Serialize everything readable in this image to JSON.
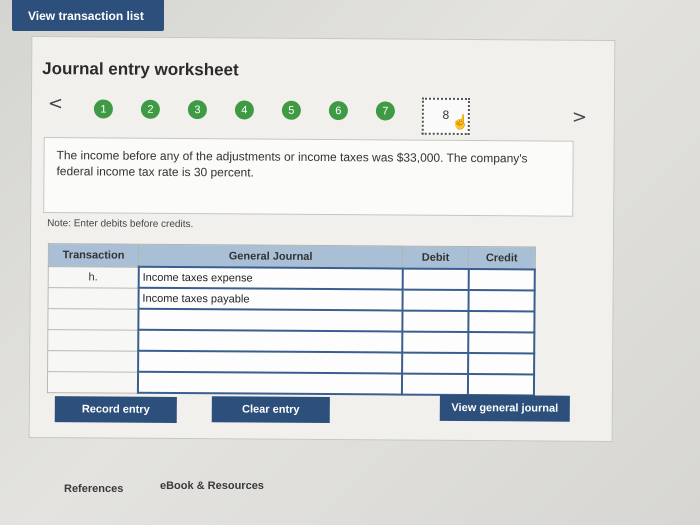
{
  "header": {
    "view_transaction_list": "View transaction list"
  },
  "worksheet": {
    "title": "Journal entry worksheet",
    "nav_prev": "<",
    "nav_next": ">",
    "steps": [
      "1",
      "2",
      "3",
      "4",
      "5",
      "6",
      "7"
    ],
    "current_step": "8",
    "description": "The income before any of the adjustments or income taxes was $33,000. The company's federal income tax rate is 30 percent.",
    "note": "Note: Enter debits before credits.",
    "table": {
      "headers": {
        "transaction": "Transaction",
        "general_journal": "General Journal",
        "debit": "Debit",
        "credit": "Credit"
      },
      "rows": [
        {
          "transaction": "h.",
          "account": "Income taxes expense",
          "debit": "",
          "credit": ""
        },
        {
          "transaction": "",
          "account": "Income taxes payable",
          "debit": "",
          "credit": ""
        },
        {
          "transaction": "",
          "account": "",
          "debit": "",
          "credit": ""
        },
        {
          "transaction": "",
          "account": "",
          "debit": "",
          "credit": ""
        },
        {
          "transaction": "",
          "account": "",
          "debit": "",
          "credit": ""
        },
        {
          "transaction": "",
          "account": "",
          "debit": "",
          "credit": ""
        }
      ]
    },
    "buttons": {
      "record": "Record entry",
      "clear": "Clear entry",
      "view_general_journal": "View general journal"
    }
  },
  "footer": {
    "references": "References",
    "ebook": "eBook & Resources"
  },
  "colors": {
    "primary": "#2d4f7c",
    "step_green": "#3f9a44",
    "table_header": "#a9bfd6"
  }
}
